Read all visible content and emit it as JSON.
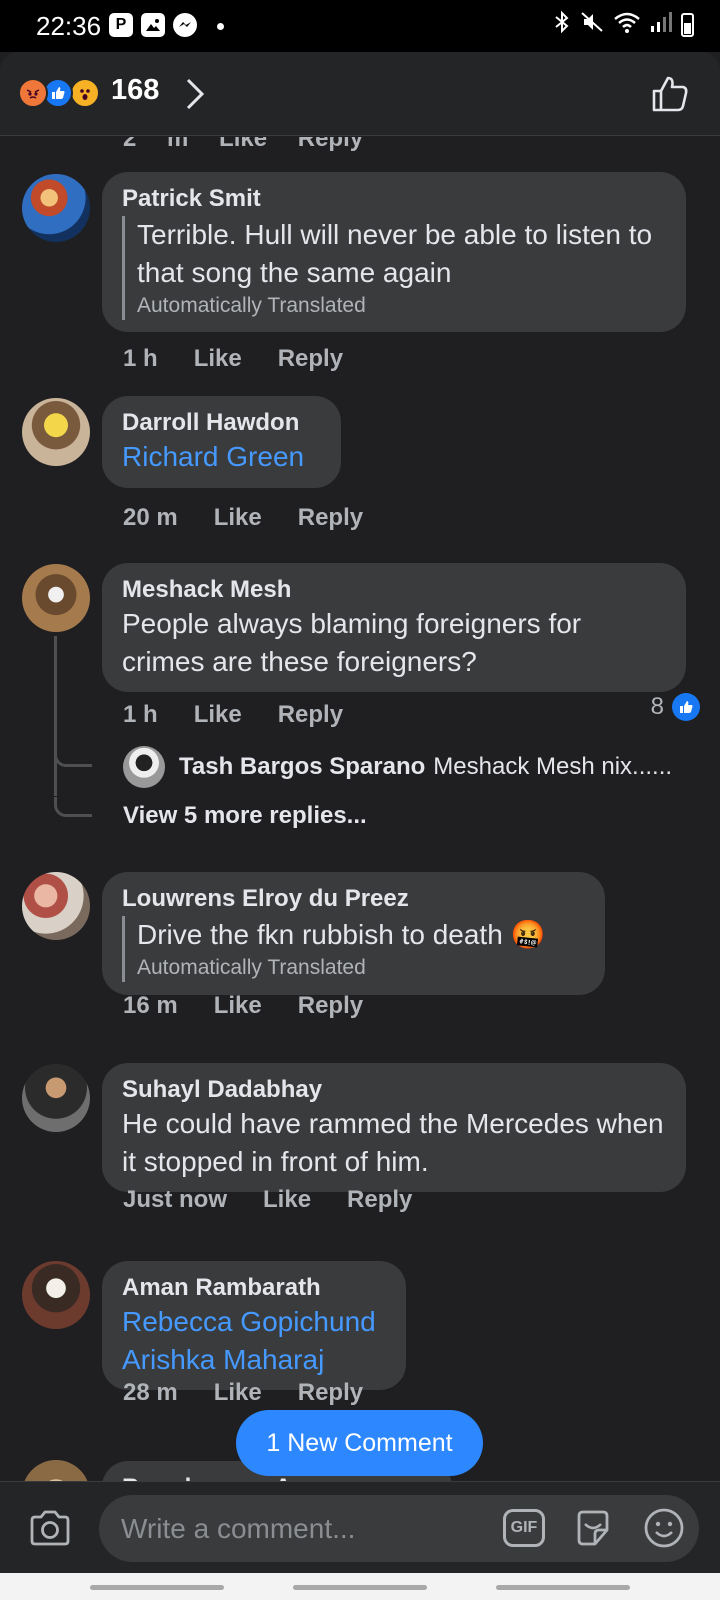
{
  "status_bar": {
    "time": "22:36",
    "app_icons": [
      "P",
      "gallery-icon",
      "messenger-icon"
    ]
  },
  "header": {
    "reaction_count": "168",
    "reactions": [
      "angry",
      "like",
      "wow"
    ]
  },
  "partial_top": {
    "time": "2 m",
    "like": "Like",
    "reply": "Reply"
  },
  "comments": [
    {
      "author": "Patrick Smit",
      "text": "Terrible. Hull will never be able to listen to that song the same again",
      "translated_label": "Automatically Translated",
      "time": "1 h",
      "like": "Like",
      "reply": "Reply"
    },
    {
      "author": "Darroll Hawdon",
      "text": "Richard Green",
      "time": "20 m",
      "like": "Like",
      "reply": "Reply"
    },
    {
      "author": "Meshack Mesh",
      "text": "People  always blaming foreigners for crimes  are these foreigners?",
      "time": "1 h",
      "like": "Like",
      "reply": "Reply",
      "like_count": "8",
      "reply_preview": {
        "author": "Tash Bargos Sparano",
        "text": "Meshack Mesh nix......"
      },
      "view_more": "View 5 more replies..."
    },
    {
      "author": "Louwrens Elroy du Preez",
      "text": "Drive the fkn rubbish to death",
      "emoji": "🤬",
      "translated_label": "Automatically Translated",
      "time": "16 m",
      "like": "Like",
      "reply": "Reply"
    },
    {
      "author": "Suhayl Dadabhay",
      "text": "He could have rammed the Mercedes when it stopped in front of him.",
      "time": "Just now",
      "like": "Like",
      "reply": "Reply"
    },
    {
      "author": "Aman Rambarath",
      "text_line1": "Rebecca Gopichund",
      "text_line2": "Arishka Maharaj",
      "time": "28 m",
      "like": "Like",
      "reply": "Reply"
    },
    {
      "author": "Brandon van Aswegen"
    }
  ],
  "new_comment_button": "1 New Comment",
  "composer": {
    "placeholder": "Write a comment...",
    "gif_label": "GIF"
  },
  "colors": {
    "background": "#1f1f21",
    "bubble": "#3a3b3c",
    "link": "#4599ff",
    "accent": "#2d88ff"
  }
}
